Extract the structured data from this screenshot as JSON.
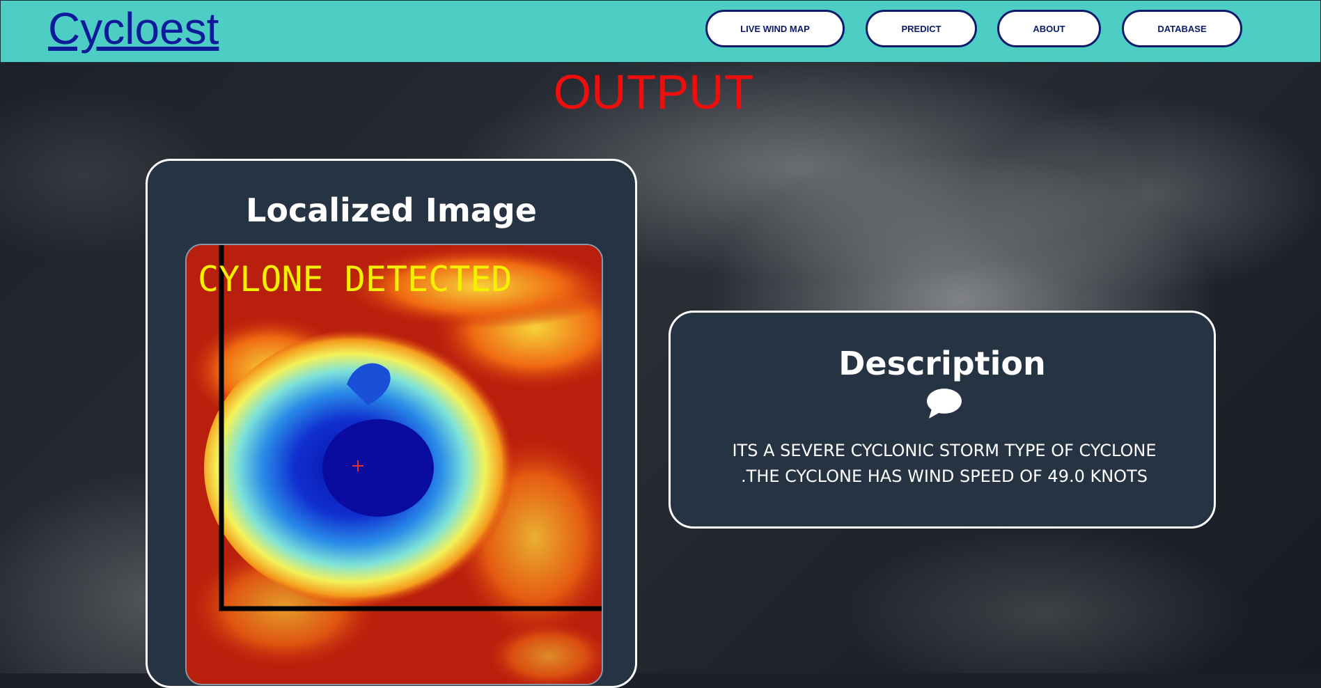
{
  "header": {
    "brand": "Cycloest",
    "nav": [
      {
        "label": "LIVE WIND MAP"
      },
      {
        "label": "PREDICT"
      },
      {
        "label": "ABOUT"
      },
      {
        "label": "DATABASE"
      }
    ]
  },
  "page": {
    "heading": "OUTPUT"
  },
  "localized_card": {
    "title": "Localized Image",
    "image_caption": "CYLONE DETECTED"
  },
  "description_card": {
    "title": "Description",
    "icon": "chat-bubble-icon",
    "text": "ITS A SEVERE CYCLONIC STORM TYPE OF CYCLONE .THE CYCLONE HAS WIND SPEED OF 49.0 KNOTS"
  },
  "colors": {
    "navbar": "#4ecdc4",
    "brand": "#0d1a9a",
    "heading": "#ee0e0e",
    "card": "#253342",
    "image_caption": "#f4f000"
  }
}
